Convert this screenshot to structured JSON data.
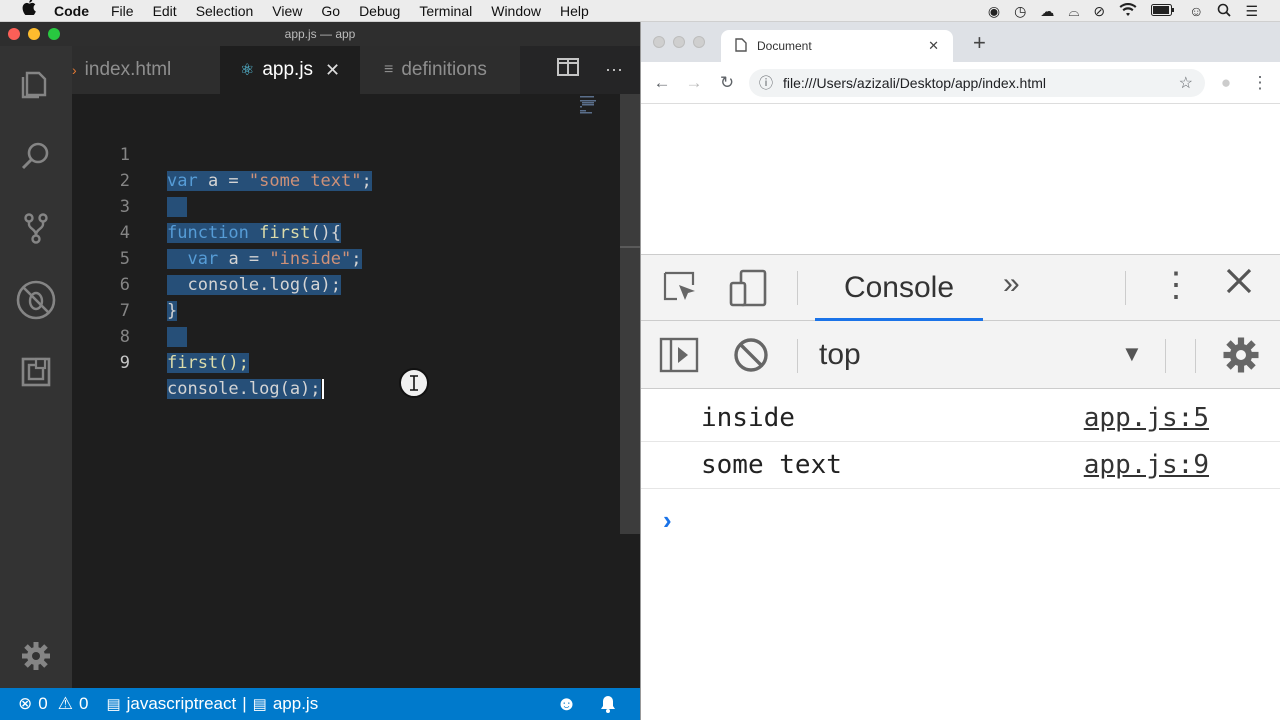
{
  "menubar": {
    "app": "Code",
    "items": [
      "File",
      "Edit",
      "Selection",
      "View",
      "Go",
      "Debug",
      "Terminal",
      "Window",
      "Help"
    ]
  },
  "vscode": {
    "title": "app.js — app",
    "tabs": [
      {
        "label": "index.html",
        "icon": "html-file-icon",
        "active": false
      },
      {
        "label": "app.js",
        "icon": "react-file-icon",
        "active": true
      },
      {
        "label": "definitions",
        "icon": "list-icon",
        "active": false
      }
    ],
    "line_numbers": [
      "1",
      "2",
      "3",
      "4",
      "5",
      "6",
      "7",
      "8",
      "9"
    ],
    "code": {
      "l1_kw": "var",
      "l1_name": " a = ",
      "l1_str": "\"some text\"",
      "l1_end": ";",
      "l3_kw": "function",
      "l3_fn": " first",
      "l3_end": "(){",
      "l4_kw": "var",
      "l4_name": " a = ",
      "l4_str": "\"inside\"",
      "l4_end": ";",
      "l5": "console.log(a);",
      "l6": "}",
      "l8": "first();",
      "l9": "console.log(a);"
    },
    "status": {
      "errors": "0",
      "warnings": "0",
      "language": "javascriptreact",
      "separator": "|",
      "file": "app.js"
    }
  },
  "chrome": {
    "tab_title": "Document",
    "url": "file:///Users/azizali/Desktop/app/index.html",
    "devtools": {
      "active_tab": "Console",
      "context": "top",
      "messages": [
        {
          "text": "inside",
          "source": "app.js:5"
        },
        {
          "text": "some text",
          "source": "app.js:9"
        }
      ],
      "prompt": "›"
    }
  },
  "colors": {
    "statusbar": "#007acc",
    "selection": "#264f78",
    "keyword": "#569cd6",
    "string": "#ce9178",
    "devtools_accent": "#1a73e8"
  }
}
